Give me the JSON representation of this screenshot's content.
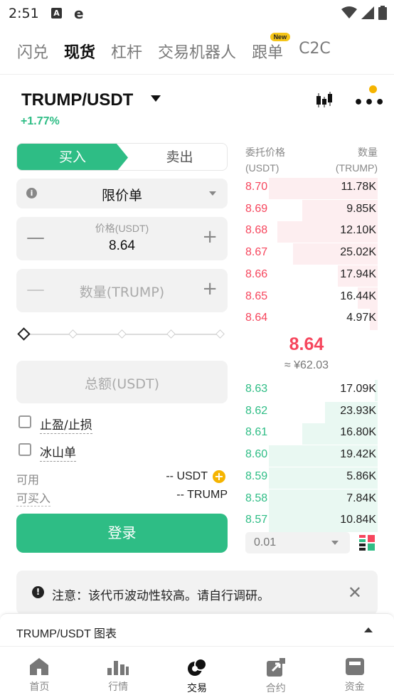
{
  "status_bar": {
    "time": "2:51",
    "icon_a": "A",
    "icon_e": "e"
  },
  "top_tabs": [
    {
      "label": "闪兑",
      "active": false
    },
    {
      "label": "现货",
      "active": true
    },
    {
      "label": "杠杆",
      "active": false
    },
    {
      "label": "交易机器人",
      "active": false
    },
    {
      "label": "跟单",
      "active": false,
      "badge": "New"
    },
    {
      "label": "C2C",
      "active": false
    }
  ],
  "pair": {
    "symbol": "TRUMP/USDT",
    "change": "+1.77%"
  },
  "trade": {
    "buy_label": "买入",
    "sell_label": "卖出",
    "order_type": "限价单",
    "price_label": "价格(USDT)",
    "price_value": "8.64",
    "qty_placeholder": "数量(TRUMP)",
    "slider_value_percent": 0,
    "total_placeholder": "总额(USDT)",
    "tp_sl_label": "止盈/止损",
    "iceberg_label": "冰山单",
    "available_label": "可用",
    "available_value": "-- USDT",
    "buyable_label": "可买入",
    "buyable_value": "-- TRUMP",
    "login_label": "登录"
  },
  "order_book": {
    "price_header": "委托价格",
    "price_unit": "(USDT)",
    "qty_header": "数量",
    "qty_unit": "(TRUMP)",
    "asks": [
      {
        "price": "8.70",
        "qty": "11.78K",
        "depth": 0.82
      },
      {
        "price": "8.69",
        "qty": "9.85K",
        "depth": 0.57
      },
      {
        "price": "8.68",
        "qty": "12.10K",
        "depth": 0.76
      },
      {
        "price": "8.67",
        "qty": "25.02K",
        "depth": 0.64
      },
      {
        "price": "8.66",
        "qty": "17.94K",
        "depth": 0.3
      },
      {
        "price": "8.65",
        "qty": "16.44K",
        "depth": 0.15
      },
      {
        "price": "8.64",
        "qty": "4.97K",
        "depth": 0.06
      }
    ],
    "mid_price": "8.64",
    "mid_cny": "≈ ¥62.03",
    "bids": [
      {
        "price": "8.63",
        "qty": "17.09K",
        "depth": 0.02
      },
      {
        "price": "8.62",
        "qty": "23.93K",
        "depth": 0.4
      },
      {
        "price": "8.61",
        "qty": "16.80K",
        "depth": 0.57
      },
      {
        "price": "8.60",
        "qty": "19.42K",
        "depth": 0.82
      },
      {
        "price": "8.59",
        "qty": "5.86K",
        "depth": 0.82
      },
      {
        "price": "8.58",
        "qty": "7.84K",
        "depth": 0.82
      },
      {
        "price": "8.57",
        "qty": "10.84K",
        "depth": 0.82
      }
    ],
    "depth_step": "0.01"
  },
  "notice": {
    "text": "注意：该代币波动性较高。请自行调研。"
  },
  "chart_bar": {
    "title": "TRUMP/USDT 图表"
  },
  "bottom_nav": [
    {
      "label": "首页",
      "icon": "home-icon",
      "active": false
    },
    {
      "label": "行情",
      "icon": "markets-icon",
      "active": false
    },
    {
      "label": "交易",
      "icon": "trade-icon",
      "active": true
    },
    {
      "label": "合约",
      "icon": "futures-icon",
      "active": false
    },
    {
      "label": "资金",
      "icon": "wallet-icon",
      "active": false
    }
  ],
  "colors": {
    "green": "#2ebd85",
    "red": "#f6465d",
    "accent_yellow": "#f5b400"
  }
}
